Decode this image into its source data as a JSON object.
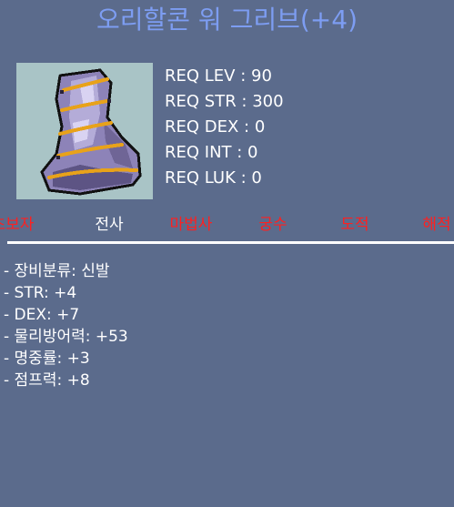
{
  "item": {
    "title": "오리할콘 워 그리브(+4)",
    "icon": "purple-armored-boots-icon"
  },
  "requirements": [
    "REQ LEV : 90",
    "REQ STR : 300",
    "REQ DEX : 0",
    "REQ INT : 0",
    "REQ LUK : 0"
  ],
  "jobs": [
    {
      "label": "초보자",
      "color": "#ff2020"
    },
    {
      "label": "전사",
      "color": "#ffffff"
    },
    {
      "label": "마법사",
      "color": "#ff2020"
    },
    {
      "label": "궁수",
      "color": "#ff2020"
    },
    {
      "label": "도적",
      "color": "#ff2020"
    },
    {
      "label": "해적",
      "color": "#ff2020"
    }
  ],
  "stats": [
    "- 장비분류: 신발",
    "- STR: +4",
    "- DEX: +7",
    "- 물리방어력: +53",
    "- 명중률: +3",
    "- 점프력: +8"
  ],
  "colors": {
    "background": "#5b6b8c",
    "title": "#7d9df2",
    "unavailable_job": "#ff2020",
    "available_job": "#ffffff"
  }
}
